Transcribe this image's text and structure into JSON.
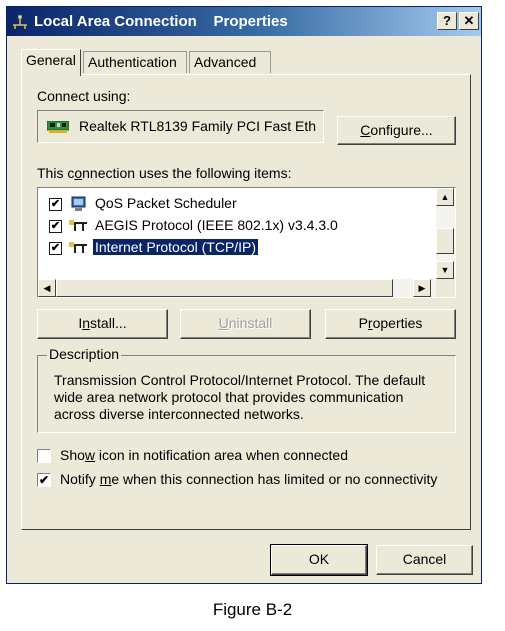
{
  "window": {
    "title": "Local Area Connection    Properties",
    "help_label": "?",
    "close_label": "✕"
  },
  "tabs": [
    {
      "label": "General",
      "active": true
    },
    {
      "label": "Authentication",
      "active": false
    },
    {
      "label": "Advanced",
      "active": false
    }
  ],
  "connect_using": {
    "label": "Connect using:",
    "adapter_name": "Realtek RTL8139 Family PCI Fast Eth",
    "adapter_icon": "network-card-icon",
    "configure_label_u": "C",
    "configure_label_rest": "onfigure..."
  },
  "items": {
    "label_pre": "This c",
    "label_u": "o",
    "label_post": "nnection uses the following items:",
    "rows": [
      {
        "text": "QoS Packet Scheduler",
        "checked": true,
        "icon": "qos-scheduler-icon",
        "selected": false
      },
      {
        "text": "AEGIS Protocol (IEEE 802.1x) v3.4.3.0",
        "checked": true,
        "icon": "network-protocol-icon",
        "selected": false
      },
      {
        "text": "Internet Protocol (TCP/IP)",
        "checked": true,
        "icon": "network-protocol-icon",
        "selected": true
      }
    ]
  },
  "buttons": {
    "install_u": "n",
    "install_pre": "I",
    "install_post": "stall...",
    "uninstall_u": "U",
    "uninstall_post": "ninstall",
    "properties_pre": "P",
    "properties_u": "r",
    "properties_post": "operties",
    "ok": "OK",
    "cancel": "Cancel"
  },
  "description": {
    "legend": "Description",
    "text": "Transmission Control Protocol/Internet Protocol. The default wide area network protocol that provides communication across diverse interconnected networks."
  },
  "options": {
    "show_icon_pre": "Sho",
    "show_icon_u": "w",
    "show_icon_post": " icon in notification area when connected",
    "show_icon_checked": false,
    "notify_pre": "Notify ",
    "notify_u": "m",
    "notify_post": "e when this connection has limited or no connectivity",
    "notify_checked": true
  },
  "caption": "Figure B-2",
  "colors": {
    "titlebar": "#0a246a",
    "face": "#ece9d8",
    "selection": "#0a246a"
  }
}
